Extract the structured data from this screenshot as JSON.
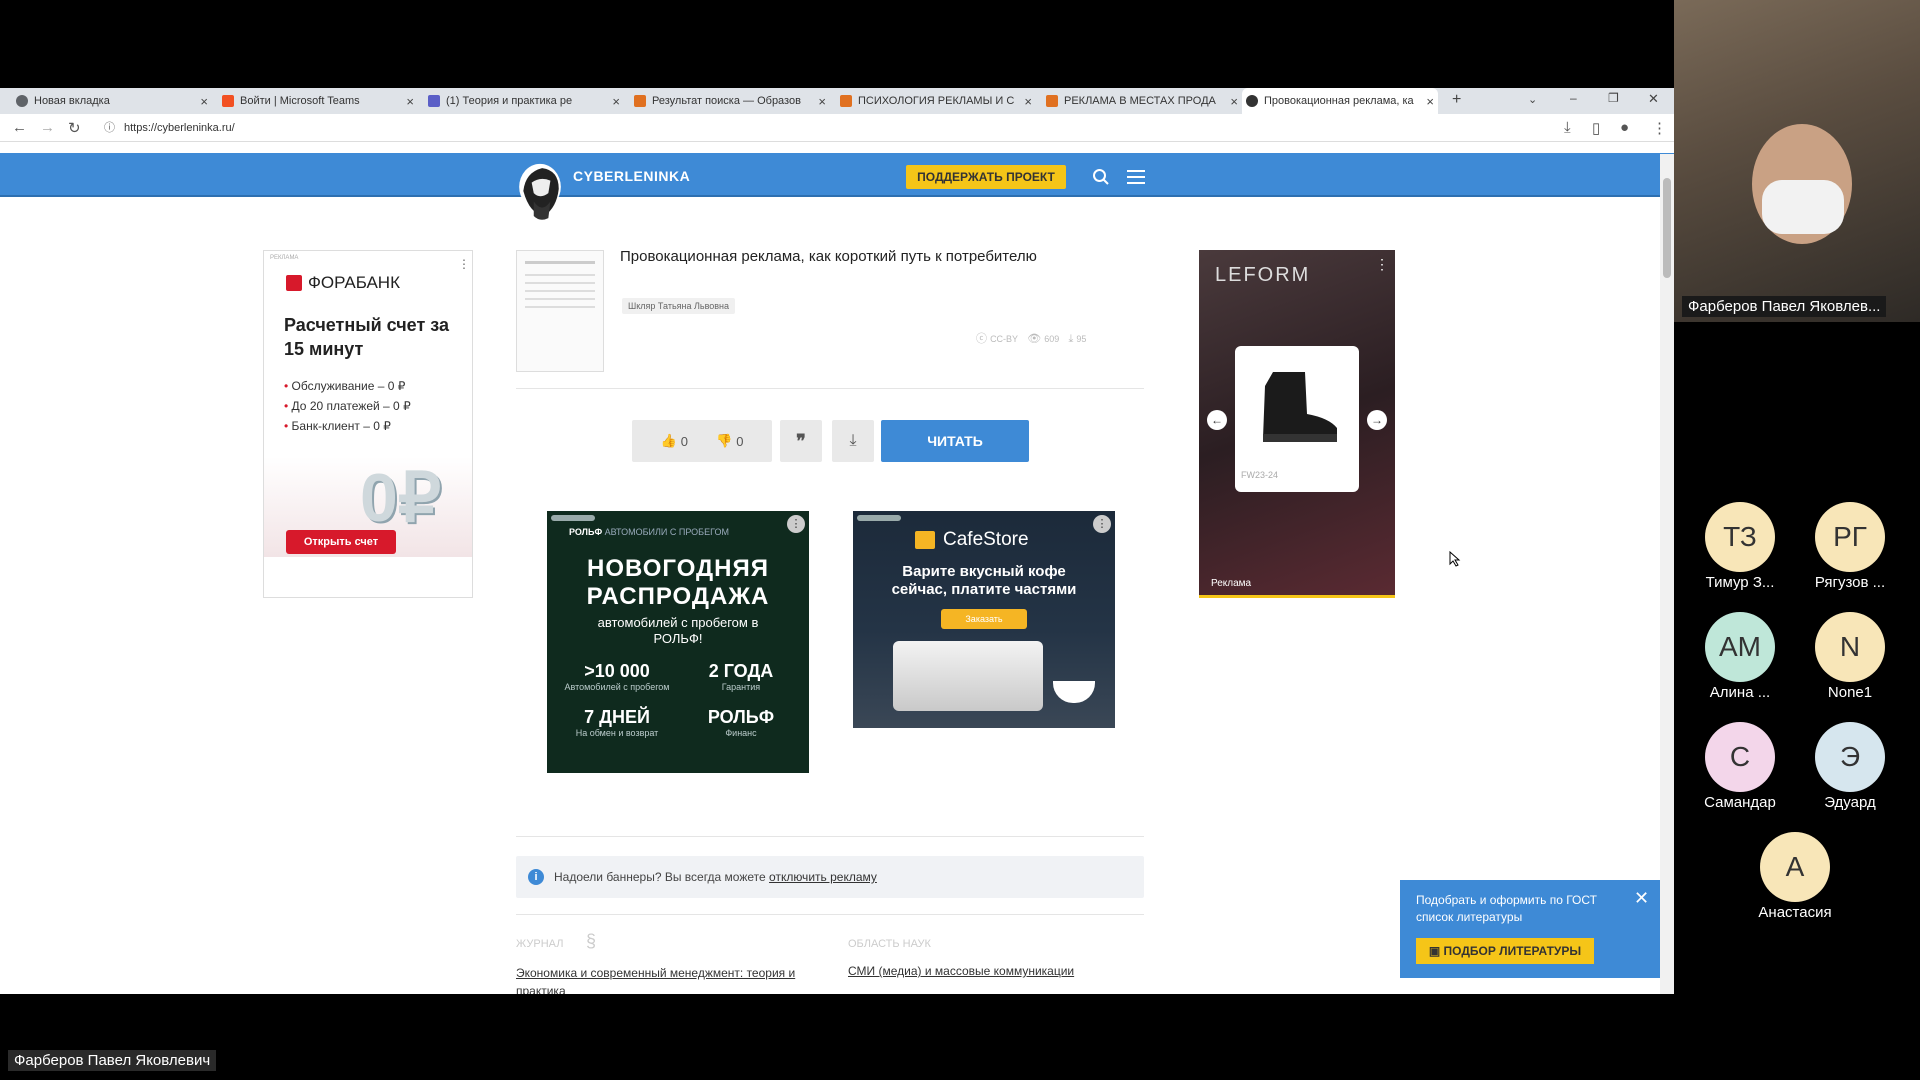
{
  "browser": {
    "tabs": [
      {
        "label": "Новая вкладка",
        "color": "#5f6368"
      },
      {
        "label": "Войти | Microsoft Teams",
        "color": "#f25022"
      },
      {
        "label": "(1) Теория и практика ре",
        "color": "#5b5fc7"
      },
      {
        "label": "Результат поиска — Образов",
        "color": "#e07020"
      },
      {
        "label": "ПСИХОЛОГИЯ РЕКЛАМЫ И С",
        "color": "#e07020"
      },
      {
        "label": "РЕКЛАМА В МЕСТАХ ПРОДА",
        "color": "#e07020"
      },
      {
        "label": "Провокационная реклама, ка",
        "color": "#333333"
      }
    ],
    "url": "https://cyberleninka.ru/"
  },
  "site": {
    "logo_text": "CYBERLENINKA",
    "support_label": "ПОДДЕРЖАТЬ ПРОЕКТ"
  },
  "article": {
    "title": "Провокационная реклама, как короткий путь к потребителю",
    "author": "Шкляр Татьяна Львовна",
    "license": "CC-BY",
    "views": "609",
    "downloads": "95",
    "likes": "0",
    "dislikes": "0",
    "read_label": "ЧИТАТЬ"
  },
  "ad_fora": {
    "label": "РЕКЛАМА",
    "brand": "ФОРАБАНК",
    "headline": "Расчетный счет за 15 минут",
    "bullets": [
      "Обслуживание – 0 ₽",
      "До 20 платежей – 0 ₽",
      "Банк-клиент – 0 ₽"
    ],
    "big": "0₽",
    "button": "Открыть счет"
  },
  "ad_rolf": {
    "brand": "РОЛЬФ",
    "tag": "АВТОМОБИЛИ С ПРОБЕГОМ",
    "headline1": "НОВОГОДНЯЯ",
    "headline2": "РАСПРОДАЖА",
    "sub": "автомобилей с пробегом в РОЛЬФ!",
    "s1_big": ">10 000",
    "s1_small": "Автомобилей с пробегом",
    "s2_big": "2 ГОДА",
    "s2_small": "Гарантия",
    "s3_big": "7 ДНЕЙ",
    "s3_small": "На обмен и возврат",
    "s4_big": "РОЛЬФ",
    "s4_small": "Финанс"
  },
  "ad_cafe": {
    "brand": "CafeStore",
    "headline": "Варите вкусный кофе сейчас, платите частями",
    "button": "Заказать"
  },
  "ad_leform": {
    "brand": "LEFORM",
    "product_code": "FW23-24",
    "ad_label": "Реклама"
  },
  "notice": {
    "text": "Надоели баннеры? Вы всегда можете ",
    "link": "отключить рекламу"
  },
  "meta": {
    "journal_label": "ЖУРНАЛ",
    "journal": "Экономика и современный менеджмент: теория и практика",
    "field_label": "ОБЛАСТЬ НАУК",
    "field": "СМИ (медиа) и массовые коммуникации"
  },
  "gost_popup": {
    "text": "Подобрать и оформить по ГОСТ список литературы",
    "button": "ПОДБОР ЛИТЕРАТУРЫ"
  },
  "zoom": {
    "presenter": "Фарберов Павел Яковлев...",
    "self_name": "Фарберов Павел Яковлевич",
    "participants": [
      {
        "initials": "ТЗ",
        "name": "Тимур З...",
        "color": "#f8e6b8"
      },
      {
        "initials": "РГ",
        "name": "Рягузов ...",
        "color": "#f8e6b8"
      },
      {
        "initials": "АМ",
        "name": "Алина ...",
        "color": "#bfe7d9"
      },
      {
        "initials": "N",
        "name": "None1",
        "color": "#f8e6b8"
      },
      {
        "initials": "С",
        "name": "Самандар",
        "color": "#f3d6ea"
      },
      {
        "initials": "Э",
        "name": "Эдуард",
        "color": "#d6e6ee"
      },
      {
        "initials": "А",
        "name": "Анастасия",
        "color": "#f8e6b8"
      }
    ]
  }
}
